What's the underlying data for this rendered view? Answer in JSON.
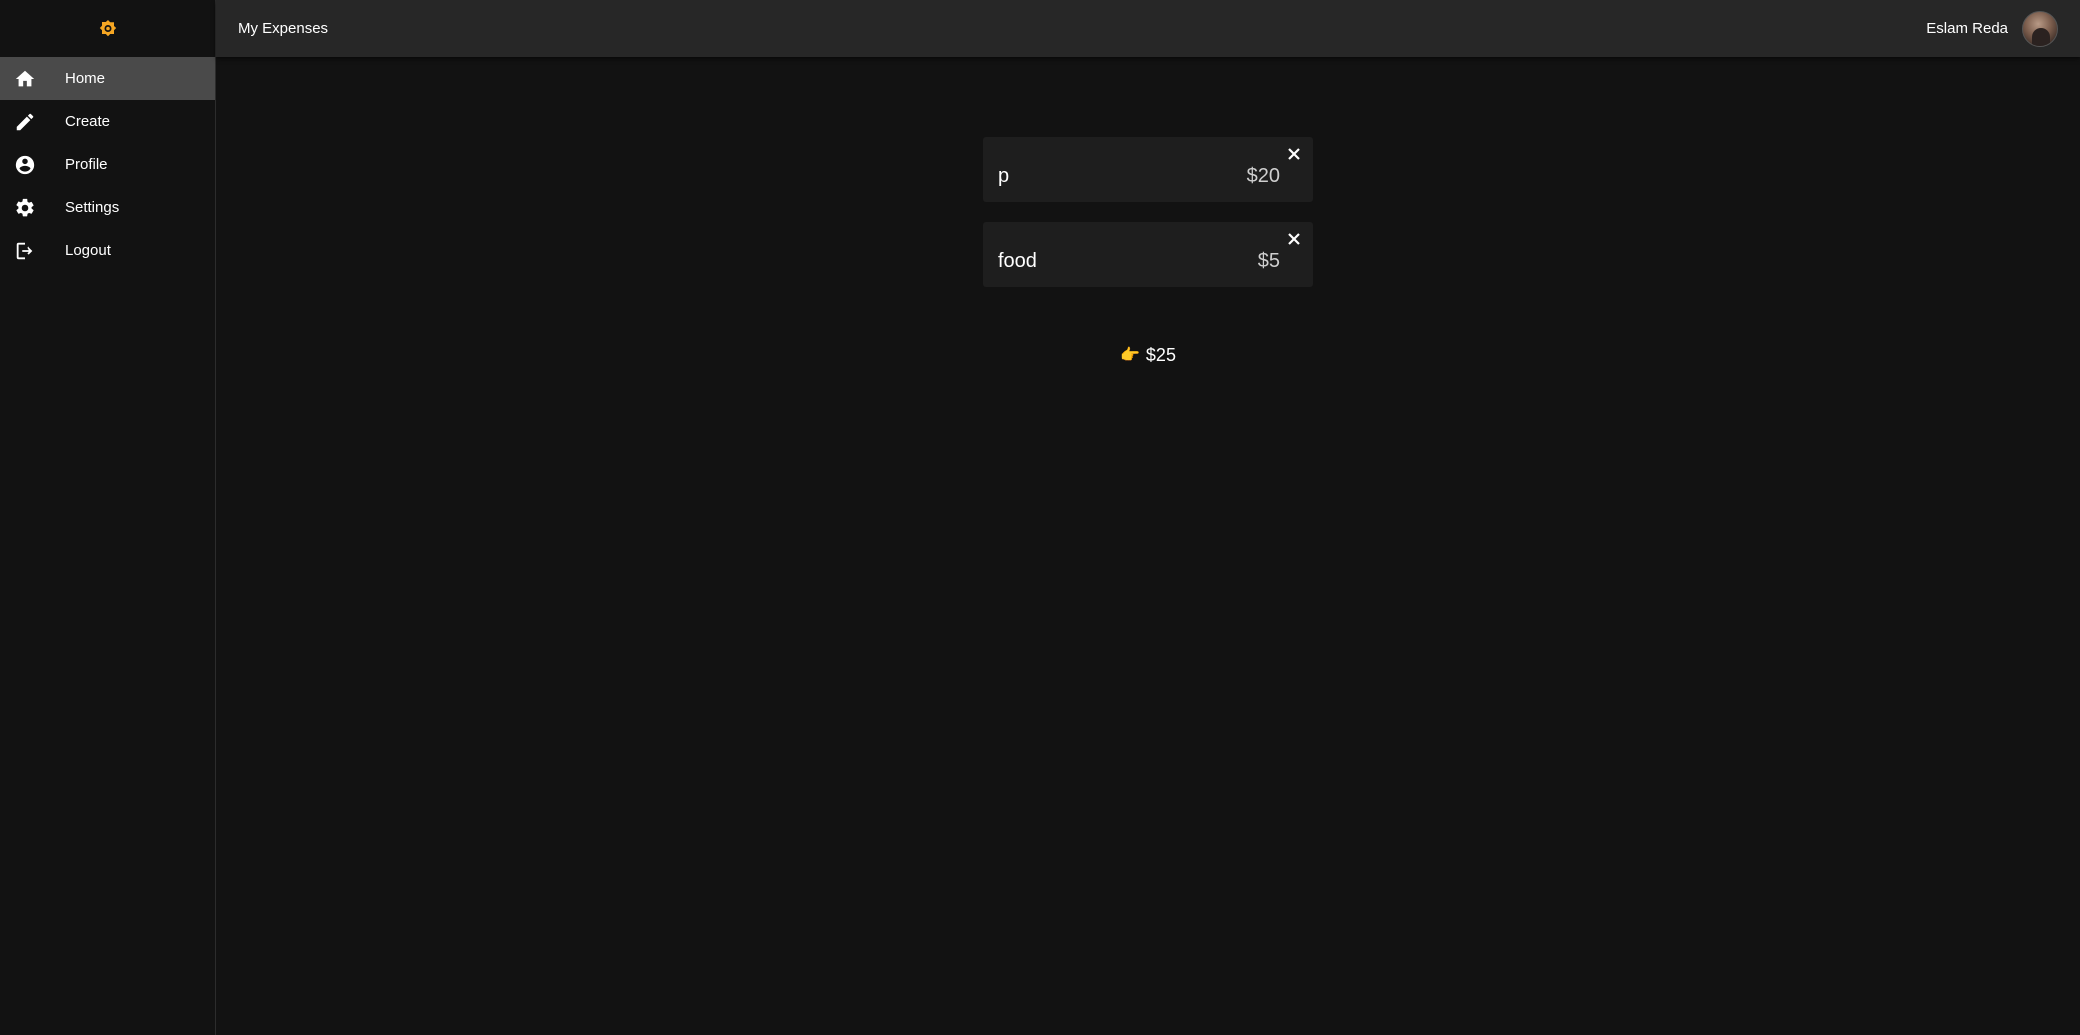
{
  "app": {
    "title": "My Expenses",
    "logo_icon": "brightness-gear-icon",
    "accent_color": "#f5a623"
  },
  "sidebar": {
    "items": [
      {
        "label": "Home",
        "icon": "home-icon",
        "active": true
      },
      {
        "label": "Create",
        "icon": "pencil-icon",
        "active": false
      },
      {
        "label": "Profile",
        "icon": "account-circle-icon",
        "active": false
      },
      {
        "label": "Settings",
        "icon": "gear-icon",
        "active": false
      },
      {
        "label": "Logout",
        "icon": "logout-icon",
        "active": false
      }
    ]
  },
  "user": {
    "name": "Eslam Reda",
    "avatar_icon": "user-avatar"
  },
  "expenses": [
    {
      "name": "p",
      "amount": "$20"
    },
    {
      "name": "food",
      "amount": "$5"
    }
  ],
  "total": {
    "icon": "pointing-hand-icon",
    "value": "$25"
  }
}
